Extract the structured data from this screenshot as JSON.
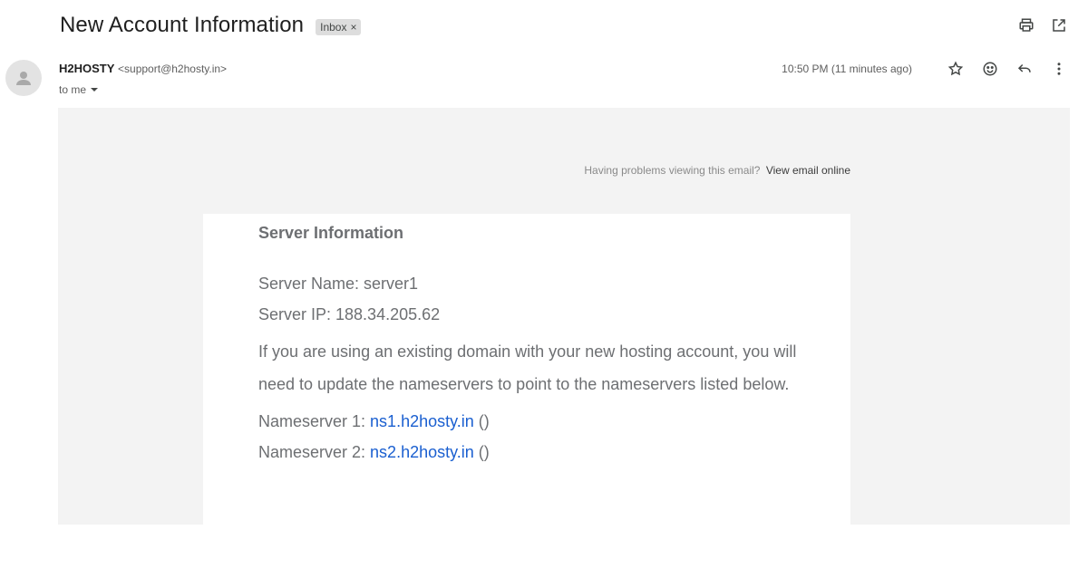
{
  "header": {
    "subject": "New Account Information",
    "label": "Inbox",
    "label_remove": "×",
    "actions": [
      {
        "name": "print-icon"
      },
      {
        "name": "open-in-new-window-icon"
      }
    ]
  },
  "message": {
    "sender_name": "H2HOSTY",
    "sender_email": "<support@h2hosty.in>",
    "recipient": "to me",
    "timestamp": "10:50 PM (11 minutes ago)",
    "actions": [
      "star-icon",
      "emoji-icon",
      "reply-icon",
      "more-vert-icon"
    ]
  },
  "email": {
    "viewing_problem": "Having problems viewing this email?",
    "view_online": "View email online",
    "heading": "Server Information",
    "server_name_label": "Server Name: server1",
    "server_ip_label": "Server IP: 188.34.205.62",
    "paragraph": "If you are using an existing domain with your new hosting account, you will need to update the nameservers to point to the nameservers listed below.",
    "nameservers": [
      {
        "prefix": "Nameserver 1: ",
        "link": "ns1.h2hosty.in",
        "suffix": " ()"
      },
      {
        "prefix": "Nameserver 2: ",
        "link": "ns2.h2hosty.in",
        "suffix": " ()"
      }
    ]
  }
}
